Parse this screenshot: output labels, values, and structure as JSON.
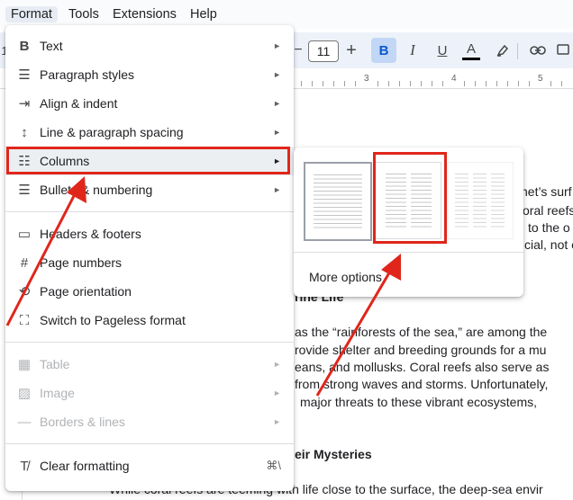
{
  "menubar": {
    "items": [
      "Format",
      "Tools",
      "Extensions",
      "Help"
    ]
  },
  "toolbar": {
    "left_fragment": "1",
    "minus": "−",
    "font_size": "11",
    "plus": "+",
    "bold": "B",
    "italic": "I",
    "underline": "U",
    "text_color": "A",
    "highlight_icon": "highlight-pen-icon",
    "link_icon": "link-icon",
    "comment_icon": "add-comment-icon"
  },
  "ruler": {
    "numbers": [
      "3",
      "4",
      "5"
    ]
  },
  "format_menu": {
    "items": [
      {
        "icon": "B",
        "icon_name": "bold-icon",
        "label": "Text",
        "submenu": true
      },
      {
        "icon": "☰",
        "icon_name": "paragraph-styles-icon",
        "label": "Paragraph styles",
        "submenu": true
      },
      {
        "icon": "⇥",
        "icon_name": "align-indent-icon",
        "label": "Align & indent",
        "submenu": true
      },
      {
        "icon": "↕",
        "icon_name": "line-spacing-icon",
        "label": "Line & paragraph spacing",
        "submenu": true
      },
      {
        "icon": "☷",
        "icon_name": "columns-icon",
        "label": "Columns",
        "submenu": true
      },
      {
        "icon": "☰",
        "icon_name": "bulleted-list-icon",
        "label": "Bullets & numbering",
        "submenu": true
      },
      {
        "icon": "▭",
        "icon_name": "headers-footers-icon",
        "label": "Headers & footers",
        "submenu": false
      },
      {
        "icon": "#",
        "icon_name": "page-numbers-icon",
        "label": "Page numbers",
        "submenu": false
      },
      {
        "icon": "⟲",
        "icon_name": "page-orientation-icon",
        "label": "Page orientation",
        "submenu": false
      },
      {
        "icon": "⛶",
        "icon_name": "pageless-icon",
        "label": "Switch to Pageless format",
        "submenu": false
      },
      {
        "icon": "▦",
        "icon_name": "table-icon",
        "label": "Table",
        "submenu": true,
        "disabled": true
      },
      {
        "icon": "▨",
        "icon_name": "image-icon",
        "label": "Image",
        "submenu": true,
        "disabled": true
      },
      {
        "icon": "—",
        "icon_name": "borders-lines-icon",
        "label": "Borders & lines",
        "submenu": true,
        "disabled": true
      },
      {
        "icon": "T̸",
        "icon_name": "clear-formatting-icon",
        "label": "Clear formatting",
        "shortcut": "⌘\\"
      }
    ],
    "submenu_arrow": "►"
  },
  "columns_submenu": {
    "options": [
      "one-column",
      "two-columns",
      "three-columns"
    ],
    "more_options": "More options"
  },
  "document": {
    "right_fragments": [
      "net’s surf",
      "oral reefs",
      "to the o",
      "cial, not c"
    ],
    "heading1_fragment": "rine Life",
    "para_lines": [
      "as the “rainforests of the sea,” are among the",
      "rovide shelter and breeding grounds for a mu",
      "eans, and mollusks. Coral reefs also serve as",
      "from strong waves and storms. Unfortunately,",
      "major threats to these vibrant ecosystems,"
    ],
    "heading2_fragment": "eir Mysteries",
    "last_line": "While coral reefs are teeming with life close to the surface, the deep-sea envir"
  },
  "annotation_color": "#e0261b"
}
